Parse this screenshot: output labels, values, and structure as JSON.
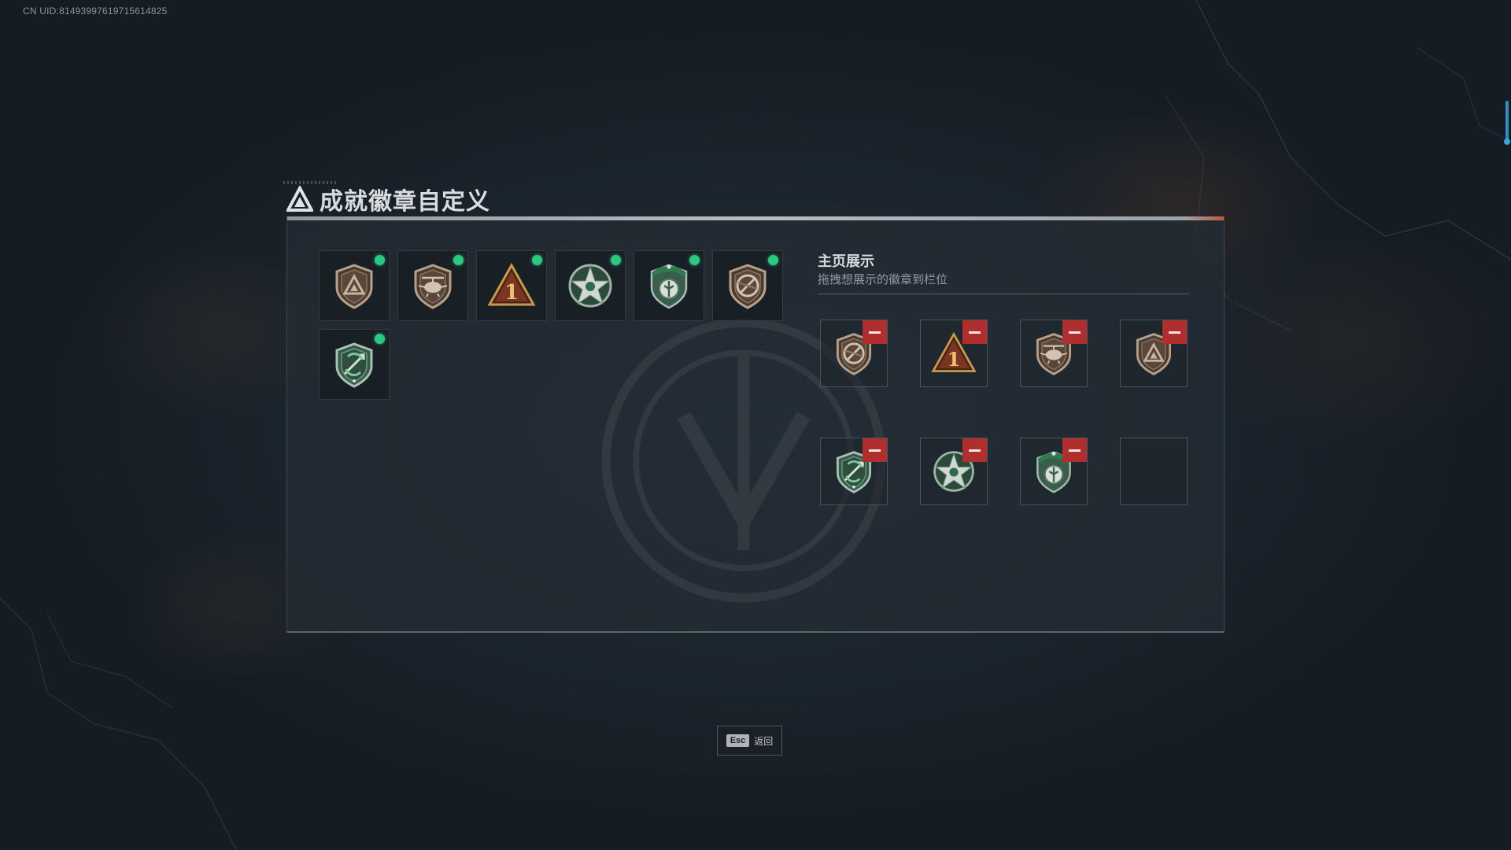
{
  "uid_text": "CN UID:81493997619715614825",
  "title": "成就徽章自定义",
  "showcase": {
    "title": "主页展示",
    "subtitle": "拖拽想展示的徽章到栏位"
  },
  "owned_badges": [
    {
      "icon": "bronze-triangle-shield-icon",
      "equipped": true
    },
    {
      "icon": "bronze-helicopter-shield-icon",
      "equipped": true
    },
    {
      "icon": "gold-number-one-triangle-icon",
      "equipped": true
    },
    {
      "icon": "green-star-compass-icon",
      "equipped": true
    },
    {
      "icon": "green-beret-shield-icon",
      "equipped": true
    },
    {
      "icon": "bronze-no-weapon-shield-icon",
      "equipped": true
    },
    {
      "icon": "green-crossed-arrows-shield-icon",
      "equipped": true
    }
  ],
  "showcase_slots": [
    {
      "icon": "bronze-no-weapon-shield-icon",
      "filled": true
    },
    {
      "icon": "gold-number-one-triangle-icon",
      "filled": true
    },
    {
      "icon": "bronze-helicopter-shield-icon",
      "filled": true
    },
    {
      "icon": "bronze-triangle-shield-icon",
      "filled": true
    },
    {
      "icon": "green-crossed-arrows-shield-icon",
      "filled": true
    },
    {
      "icon": "green-star-compass-icon",
      "filled": true
    },
    {
      "icon": "green-beret-shield-icon",
      "filled": true
    },
    {
      "icon": "",
      "filled": false
    }
  ],
  "badge_number_text": "1",
  "esc": {
    "key": "Esc",
    "label": "返回"
  },
  "colors": {
    "equipped_dot": "#29c97f",
    "remove_button": "#b12e2e",
    "accent_blue": "#2f8fc4"
  }
}
